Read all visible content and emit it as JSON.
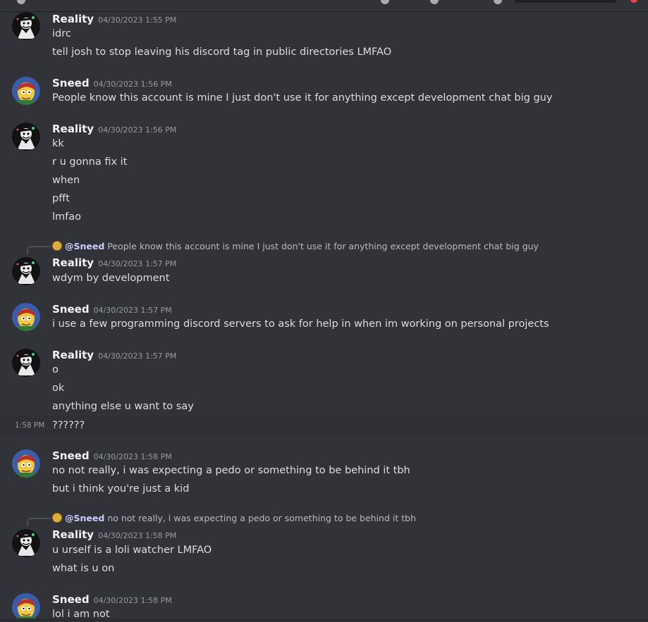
{
  "topbar": {
    "icons": [
      "threads-icon",
      "pin-icon",
      "members-icon",
      "search-box",
      "inbox-icon"
    ]
  },
  "messages": [
    {
      "author": "Reality",
      "timestamp": "04/30/2023 1:55 PM",
      "avatar": "reality-avatar",
      "lines": [
        "idrc",
        "tell josh to stop leaving his discord tag in public directories LMFAO"
      ]
    },
    {
      "author": "Sneed",
      "timestamp": "04/30/2023 1:56 PM",
      "avatar": "sneed-avatar",
      "lines": [
        "People know this account is mine I just don't use it for anything except development chat big guy"
      ]
    },
    {
      "author": "Reality",
      "timestamp": "04/30/2023 1:56 PM",
      "avatar": "reality-avatar",
      "lines": [
        "kk",
        "r u gonna fix it",
        "when",
        "pfft",
        "lmfao"
      ]
    },
    {
      "reply": {
        "mention": "@Sneed",
        "text": "People know this account is mine I just don't use it for anything except development chat big guy"
      },
      "author": "Reality",
      "timestamp": "04/30/2023 1:57 PM",
      "avatar": "reality-avatar",
      "lines": [
        "wdym by development"
      ]
    },
    {
      "author": "Sneed",
      "timestamp": "04/30/2023 1:57 PM",
      "avatar": "sneed-avatar",
      "lines": [
        "i use a few programming discord servers to ask for help in when im working on personal projects"
      ]
    },
    {
      "author": "Reality",
      "timestamp": "04/30/2023 1:57 PM",
      "avatar": "reality-avatar",
      "lines": [
        "o",
        "ok",
        "anything else u want to say"
      ],
      "followup": {
        "time": "1:58 PM",
        "text": "??????"
      }
    },
    {
      "author": "Sneed",
      "timestamp": "04/30/2023 1:58 PM",
      "avatar": "sneed-avatar",
      "lines": [
        "no not really, i was expecting a pedo or something to be behind it tbh",
        "but i think you're just a kid"
      ]
    },
    {
      "reply": {
        "mention": "@Sneed",
        "text": "no not really, i was expecting a pedo or something to be behind it tbh"
      },
      "author": "Reality",
      "timestamp": "04/30/2023 1:58 PM",
      "avatar": "reality-avatar",
      "lines": [
        "u urself is a loli watcher LMFAO",
        "what is u on"
      ]
    },
    {
      "author": "Sneed",
      "timestamp": "04/30/2023 1:58 PM",
      "avatar": "sneed-avatar",
      "lines": [
        "lol i am not"
      ]
    }
  ]
}
